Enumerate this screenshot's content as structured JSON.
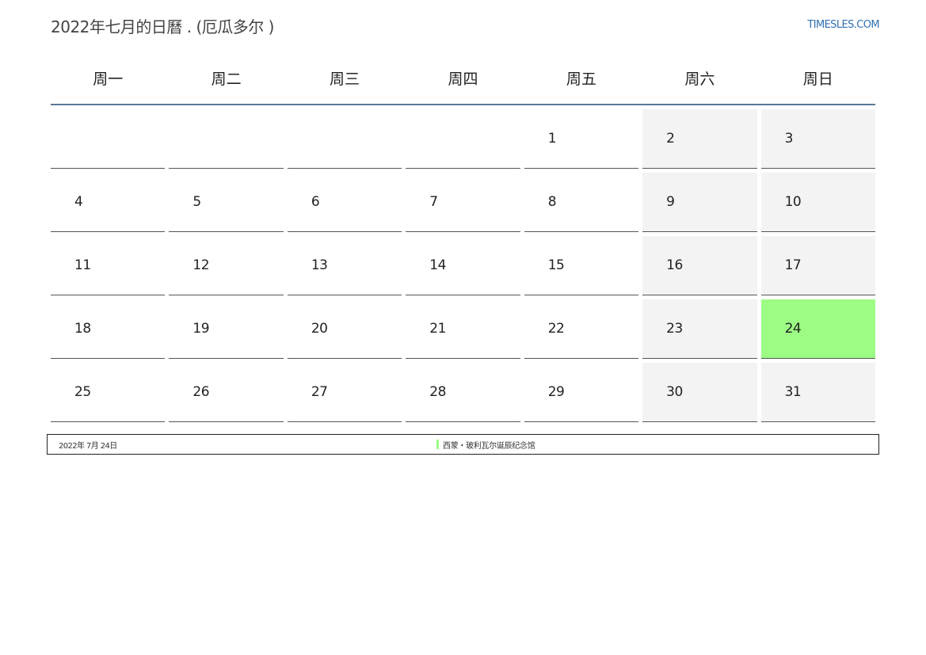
{
  "header": {
    "title": "2022年七月的日曆 . (厄瓜多尔 )",
    "site": "TIMESLES.COM"
  },
  "weekdays": [
    "周一",
    "周二",
    "周三",
    "周四",
    "周五",
    "周六",
    "周日"
  ],
  "weeks": [
    [
      "",
      "",
      "",
      "",
      "1",
      "2",
      "3"
    ],
    [
      "4",
      "5",
      "6",
      "7",
      "8",
      "9",
      "10"
    ],
    [
      "11",
      "12",
      "13",
      "14",
      "15",
      "16",
      "17"
    ],
    [
      "18",
      "19",
      "20",
      "21",
      "22",
      "23",
      "24"
    ],
    [
      "25",
      "26",
      "27",
      "28",
      "29",
      "30",
      "31"
    ]
  ],
  "highlighted_day": "24",
  "colors": {
    "holiday": "#9cfc84",
    "weekend": "#f3f3f3",
    "header_rule": "#5a7896",
    "site_link": "#2f6fb1"
  },
  "notes": [
    {
      "date": "2022年 7月 24日",
      "text": "西蒙・玻利瓦尔诞辰纪念馆"
    }
  ]
}
